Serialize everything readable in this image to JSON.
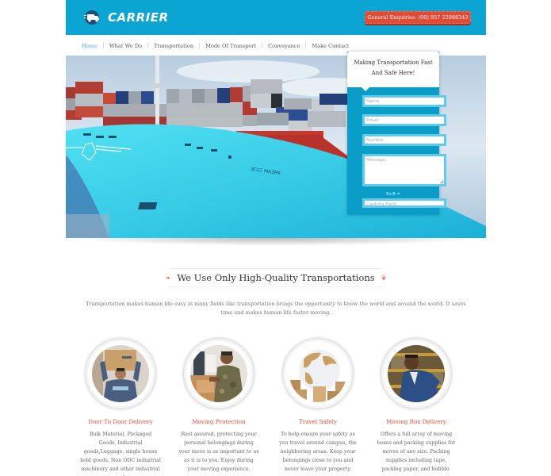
{
  "header": {
    "logo_text": "CARRIER",
    "logo_icon": "delivery-truck-icon",
    "enquiry_label": "General Enquiries: (00) 957 22988343",
    "brand_color": "#0ba5d4",
    "accent_color": "#e14a34"
  },
  "nav": {
    "items": [
      {
        "label": "Home",
        "active": true
      },
      {
        "label": "What We Do"
      },
      {
        "label": "Transportation"
      },
      {
        "label": "Mode Of Transport"
      },
      {
        "label": "Conveyance"
      },
      {
        "label": "Make Contact"
      }
    ]
  },
  "hero": {
    "image": "container-ship-bow-photo"
  },
  "form": {
    "title": "Making Transportation Fast And Safe Here!",
    "name_placeholder": "Name",
    "email_placeholder": "Email",
    "number_placeholder": "Number",
    "message_placeholder": "Message",
    "captcha_question": "9+8 =",
    "captcha_placeholder": "Captcha Field"
  },
  "section": {
    "title": "We Use Only High-Quality Transportations",
    "intro": "Transportation makes human life easy in many fields like transportation brings the opportunity to know the world and around the world. It saves time and makes human life faster moving."
  },
  "features": [
    {
      "title": "Door To Door Delivery",
      "text": "Bulk Material, Packaged Goods, Industrial goods,Luggage, single house hold goods, Non ODC industrial machinery and other industrial goods.",
      "image": "man-carrying-box-photo"
    },
    {
      "title": "Moving Protection",
      "text": "Rest assured, protecting your personal belongings during your move is as important to us as it is to you. Enjoy during your moving experience.",
      "image": "soldier-packing-boxes-photo"
    },
    {
      "title": "Travel Safely",
      "text": "To help ensure your safety as you travel around campus, the neighboring areas. Keep your belongings close to you and never leave your property.",
      "image": "globe-with-boxes-photo"
    },
    {
      "title": "Moving Box Delivery",
      "text": "Offers a full array of moving boxes and packing supplies for moves of any size. Packing supplies including tape, packing paper, and bubble-wrap.",
      "image": "warehouse-worker-photo"
    }
  ]
}
